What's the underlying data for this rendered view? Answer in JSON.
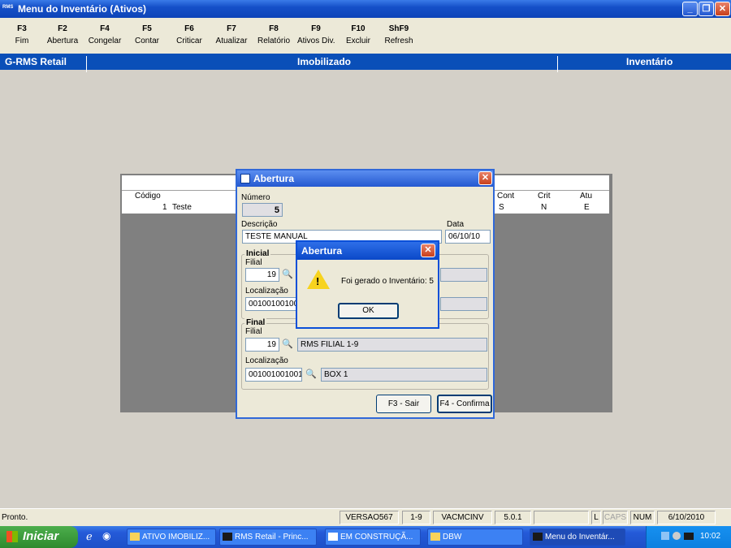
{
  "window": {
    "app_icon": "RMS",
    "title": "Menu do Inventário (Ativos)",
    "controls": [
      "minimize",
      "maximize",
      "close"
    ]
  },
  "toolbar": [
    {
      "key": "F3",
      "label": "Fim"
    },
    {
      "key": "F2",
      "label": "Abertura"
    },
    {
      "key": "F4",
      "label": "Congelar"
    },
    {
      "key": "F5",
      "label": "Contar"
    },
    {
      "key": "F6",
      "label": "Criticar"
    },
    {
      "key": "F7",
      "label": "Atualizar"
    },
    {
      "key": "F8",
      "label": "Relatório"
    },
    {
      "key": "F9",
      "label": "Ativos Div."
    },
    {
      "key": "F10",
      "label": "Excluir"
    },
    {
      "key": "ShF9",
      "label": "Refresh"
    }
  ],
  "header_band": {
    "left": "G-RMS Retail",
    "center": "Imobilizado",
    "right": "Inventário"
  },
  "grid": {
    "columns": {
      "codigo": "Código",
      "cont": "Cont",
      "crit": "Crit",
      "atu": "Atu"
    },
    "rows": [
      {
        "codigo": "1",
        "descricao": "Teste",
        "cont": "S",
        "crit": "N",
        "atu": "E"
      }
    ]
  },
  "dialog": {
    "title": "Abertura",
    "numero_label": "Número",
    "numero": "5",
    "descricao_label": "Descrição",
    "descricao": "TESTE MANUAL",
    "data_label": "Data",
    "data": "06/10/10",
    "inicial": {
      "group_label": "Inicial",
      "filial_label": "Filial",
      "filial": "19",
      "localizacao_label": "Localização",
      "localizacao": "00100100100"
    },
    "final": {
      "group_label": "Final",
      "filial_label": "Filial",
      "filial": "19",
      "filial_nome": "RMS FILIAL 1-9",
      "localizacao_label": "Localização",
      "localizacao": "001001001001",
      "localizacao_nome": "BOX 1"
    },
    "sair_button": "F3 - Sair",
    "confirma_button": "F4 - Confirma"
  },
  "message": {
    "title": "Abertura",
    "text": "Foi gerado o Inventário: 5",
    "ok_button": "OK"
  },
  "status_bar": {
    "text": "Pronto.",
    "version": "VERSAO567",
    "range": "1-9",
    "module": "VACMCINV",
    "release": "5.0.1",
    "l": "L",
    "caps": "CAPS",
    "num": "NUM",
    "date": "6/10/2010"
  },
  "taskbar": {
    "start": "Iniciar",
    "tasks": [
      {
        "label": "ATIVO IMOBILIZ...",
        "icon": "folder-icon"
      },
      {
        "label": "RMS Retail - Princ...",
        "icon": "rms-icon"
      },
      {
        "label": "EM CONSTRUÇÃ...",
        "icon": "document-icon"
      },
      {
        "label": "DBW",
        "icon": "folder-icon"
      },
      {
        "label": "Menu do Inventár...",
        "icon": "rms-icon"
      }
    ],
    "clock": "10:02"
  },
  "colors": {
    "title_blue": "#0a4fb8",
    "face": "#ece9d8",
    "grid_bg": "#808080"
  }
}
